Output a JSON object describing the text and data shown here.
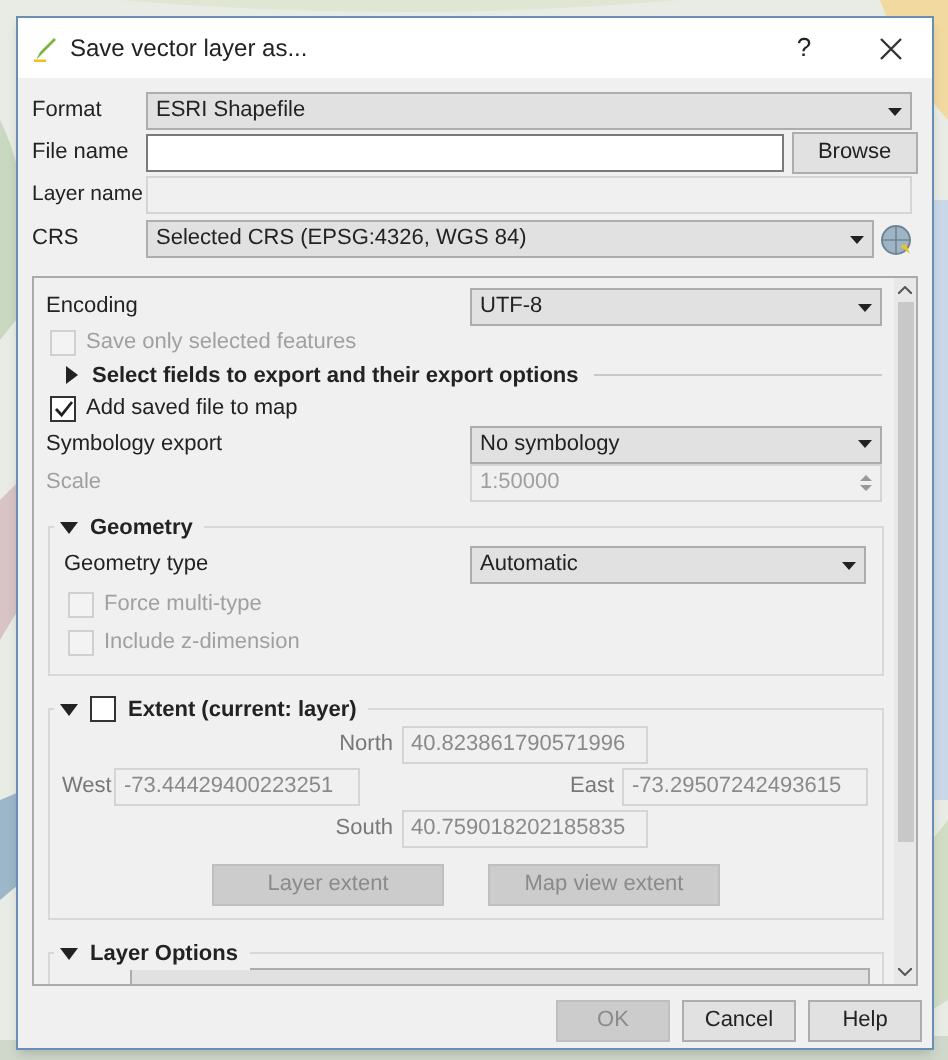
{
  "window": {
    "title": "Save vector layer as...",
    "help": "?"
  },
  "format": {
    "label": "Format",
    "value": "ESRI Shapefile"
  },
  "file_name": {
    "label": "File name",
    "button": "Browse"
  },
  "layer_name": {
    "label": "Layer name",
    "disabled": true
  },
  "crs": {
    "label": "CRS",
    "value": "Selected CRS (EPSG:4326, WGS 84)"
  },
  "options": [
    {
      "kind": "combo",
      "label": "Encoding",
      "value": "UTF-8",
      "disabled": false
    },
    {
      "kind": "check",
      "label": "Save only selected features",
      "checked": false,
      "disabled": true
    },
    {
      "kind": "section",
      "label": "Select fields to export and their export options",
      "expanded": false
    },
    {
      "kind": "check",
      "label": "Add saved file to map",
      "checked": true,
      "disabled": false
    },
    {
      "kind": "combo",
      "label": "Symbology export",
      "value": "No symbology",
      "disabled": false
    },
    {
      "kind": "spin",
      "label": "Scale",
      "value": "1:50000",
      "disabled": true
    }
  ],
  "geometry": {
    "title": "Geometry",
    "expanded": true,
    "rows": [
      {
        "kind": "combo",
        "label": "Geometry type",
        "value": "Automatic",
        "disabled": false
      },
      {
        "kind": "check",
        "label": "Force multi-type",
        "checked": false,
        "disabled": true
      },
      {
        "kind": "check",
        "label": "Include z-dimension",
        "checked": false,
        "disabled": true
      }
    ]
  },
  "extent": {
    "title": "Extent (current: layer)",
    "expanded": true,
    "checked": false,
    "north": {
      "label": "North",
      "value": "40.823861790571996"
    },
    "west": {
      "label": "West",
      "value": "-73.44429400223251"
    },
    "east": {
      "label": "East",
      "value": "-73.29507242493615"
    },
    "south": {
      "label": "South",
      "value": "40.759018202185835"
    },
    "buttons": [
      {
        "label": "Layer extent",
        "disabled": true
      },
      {
        "label": "Map view extent",
        "disabled": true
      }
    ]
  },
  "layer_options": {
    "title": "Layer Options",
    "expanded": true
  },
  "buttons": [
    {
      "label": "OK",
      "disabled": true
    },
    {
      "label": "Cancel",
      "disabled": false
    },
    {
      "label": "Help",
      "disabled": false
    }
  ]
}
